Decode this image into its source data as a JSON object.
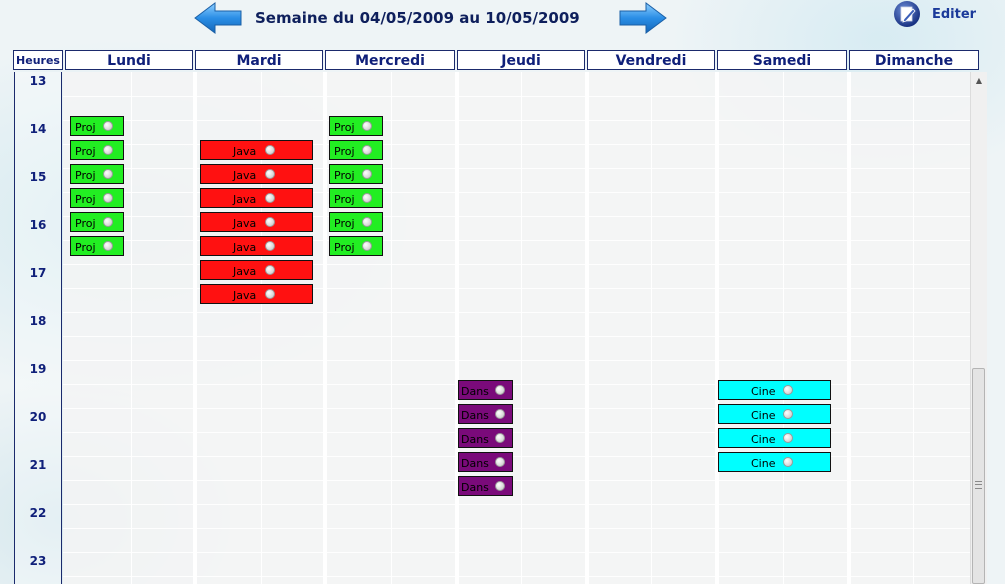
{
  "header": {
    "week_title": "Semaine du 04/05/2009 au 10/05/2009",
    "edit_label": "Editer",
    "prev_icon": "arrow-left-icon",
    "next_icon": "arrow-right-icon",
    "edit_icon": "edit-pencil-icon"
  },
  "columns": {
    "hours": "Heures",
    "days": [
      "Lundi",
      "Mardi",
      "Mercredi",
      "Jeudi",
      "Vendredi",
      "Samedi",
      "Dimanche"
    ]
  },
  "hours": [
    "13",
    "14",
    "15",
    "16",
    "17",
    "18",
    "19",
    "20",
    "21",
    "22",
    "23"
  ],
  "colors": {
    "Proj": "#22ee22",
    "Java": "#ff1111",
    "Dans": "#7a0a7a",
    "Cine": "#00ffff",
    "header_text": "#10207a"
  },
  "events": {
    "lundi": [
      "Proj",
      "Proj",
      "Proj",
      "Proj",
      "Proj",
      "Proj"
    ],
    "mardi": [
      "Java",
      "Java",
      "Java",
      "Java",
      "Java",
      "Java",
      "Java"
    ],
    "mercredi": [
      "Proj",
      "Proj",
      "Proj",
      "Proj",
      "Proj",
      "Proj"
    ],
    "jeudi": [
      "Dans",
      "Dans",
      "Dans",
      "Dans",
      "Dans"
    ],
    "samedi": [
      "Cine",
      "Cine",
      "Cine",
      "Cine"
    ]
  }
}
